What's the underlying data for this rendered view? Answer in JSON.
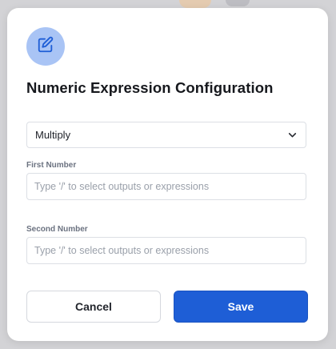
{
  "dialog": {
    "title": "Numeric Expression Configuration",
    "icon": "edit-icon",
    "accent_color": "#1e5ed6",
    "icon_badge_color": "#a9c4f5"
  },
  "operation_select": {
    "selected_value": "Multiply",
    "icon": "chevron-down-icon"
  },
  "first_number": {
    "label": "First Number",
    "value": "",
    "placeholder": "Type '/' to select outputs or expressions"
  },
  "second_number": {
    "label": "Second Number",
    "value": "",
    "placeholder": "Type '/' to select outputs or expressions"
  },
  "buttons": {
    "cancel_label": "Cancel",
    "save_label": "Save"
  }
}
